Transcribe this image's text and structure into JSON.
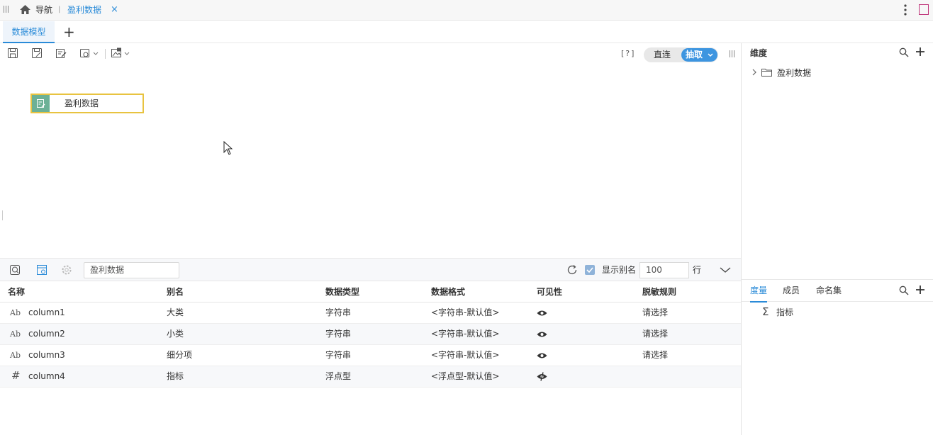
{
  "topbar": {
    "home_label": "导航",
    "separator": "|",
    "tab_label": "盈利数据",
    "close_glyph": "×"
  },
  "model_tabs": {
    "active_tab": "数据模型",
    "add_glyph": "+"
  },
  "canvas": {
    "help_label": "[?]",
    "mode_direct": "直连",
    "mode_extract": "抽取",
    "node_label": "盈利数据"
  },
  "table_toolbar": {
    "table_name": "盈利数据",
    "show_alias_label": "显示别名",
    "row_count": "100",
    "row_unit": "行"
  },
  "table": {
    "headers": [
      "名称",
      "别名",
      "数据类型",
      "数据格式",
      "可见性",
      "脱敏规则"
    ],
    "rows": [
      {
        "type_icon": "Ab",
        "name": "column1",
        "alias": "大类",
        "data_type": "字符串",
        "format": "<字符串-默认值>",
        "visibility": "visible",
        "mask": "请选择"
      },
      {
        "type_icon": "Ab",
        "name": "column2",
        "alias": "小类",
        "data_type": "字符串",
        "format": "<字符串-默认值>",
        "visibility": "visible",
        "mask": "请选择"
      },
      {
        "type_icon": "Ab",
        "name": "column3",
        "alias": "细分项",
        "data_type": "字符串",
        "format": "<字符串-默认值>",
        "visibility": "visible",
        "mask": "请选择"
      },
      {
        "type_icon": "#",
        "name": "column4",
        "alias": "指标",
        "data_type": "浮点型",
        "format": "<浮点型-默认值>",
        "visibility": "partial",
        "mask": ""
      }
    ]
  },
  "right_panel": {
    "dimension_title": "维度",
    "tree_folder": "盈利数据",
    "measure_tabs": [
      "度量",
      "成员",
      "命名集"
    ],
    "measure_item": "指标",
    "sigma": "Σ"
  },
  "colors": {
    "accent": "#2a8bd8",
    "node_border": "#e8c340",
    "node_icon_bg": "#6cb196",
    "extract_bg": "#3d95e0"
  }
}
